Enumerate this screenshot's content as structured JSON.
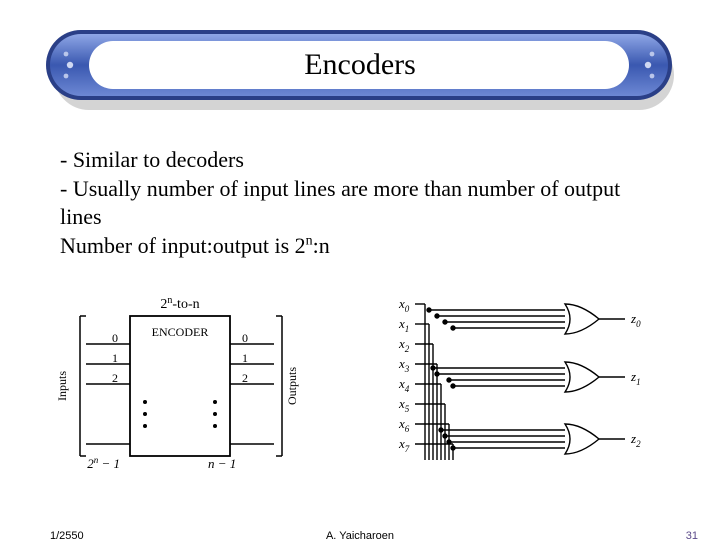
{
  "title": "Encoders",
  "body": {
    "line1": "- Similar to decoders",
    "line2": "- Usually number of input lines are more than number of output lines",
    "line3_a": "Number of input:output is 2",
    "line3_sup": "n",
    "line3_b": ":n"
  },
  "diagram1": {
    "top_label_a": "2",
    "top_label_sup": "n",
    "top_label_b": "-to-n",
    "box_label": "ENCODER",
    "inputs_label": "Inputs",
    "outputs_label": "Outputs",
    "in_top": "0",
    "in_1": "1",
    "in_2": "2",
    "in_bot_a": "2",
    "in_bot_sup": "n",
    "in_bot_b": " − 1",
    "out_top": "0",
    "out_1": "1",
    "out_2": "2",
    "out_bot": "n − 1"
  },
  "diagram2": {
    "x0": "x",
    "x0s": "0",
    "x1": "x",
    "x1s": "1",
    "x2": "x",
    "x2s": "2",
    "x3": "x",
    "x3s": "3",
    "x4": "x",
    "x4s": "4",
    "x5": "x",
    "x5s": "5",
    "x6": "x",
    "x6s": "6",
    "x7": "x",
    "x7s": "7",
    "z0": "z",
    "z0s": "0",
    "z1": "z",
    "z1s": "1",
    "z2": "z",
    "z2s": "2"
  },
  "footer": {
    "left": "1/2550",
    "center": "A. Yaicharoen",
    "right": "31"
  }
}
